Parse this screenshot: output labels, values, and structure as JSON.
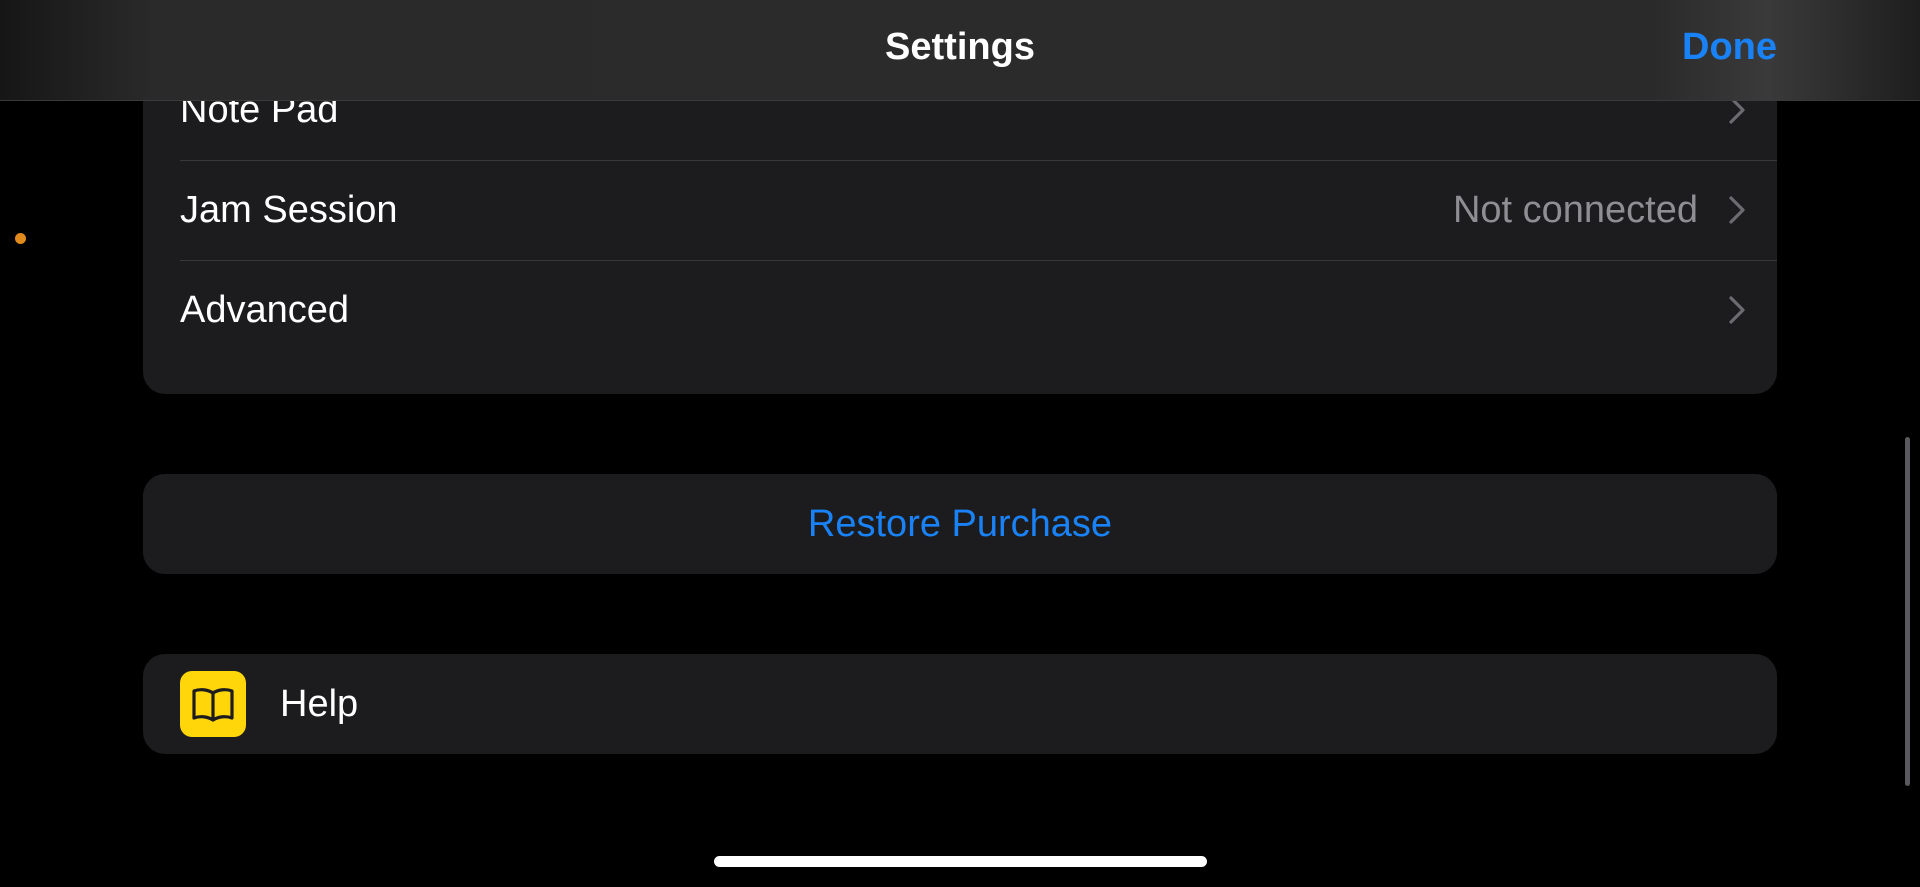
{
  "navbar": {
    "title": "Settings",
    "done_label": "Done"
  },
  "settings_list": {
    "items": [
      {
        "label": "Note Pad",
        "value": "",
        "icon": "chevron-right-icon"
      },
      {
        "label": "Jam Session",
        "value": "Not connected",
        "icon": "chevron-right-icon"
      },
      {
        "label": "Advanced",
        "value": "",
        "icon": "chevron-right-icon"
      }
    ]
  },
  "restore": {
    "label": "Restore Purchase"
  },
  "help": {
    "label": "Help",
    "icon": "book-icon"
  },
  "colors": {
    "accent": "#1a82f7",
    "background": "#000000",
    "group_background": "#1c1c1e",
    "secondary_text": "#8e8e93",
    "help_icon_background": "#ffd60a",
    "indicator_dot": "#e08a1e"
  }
}
